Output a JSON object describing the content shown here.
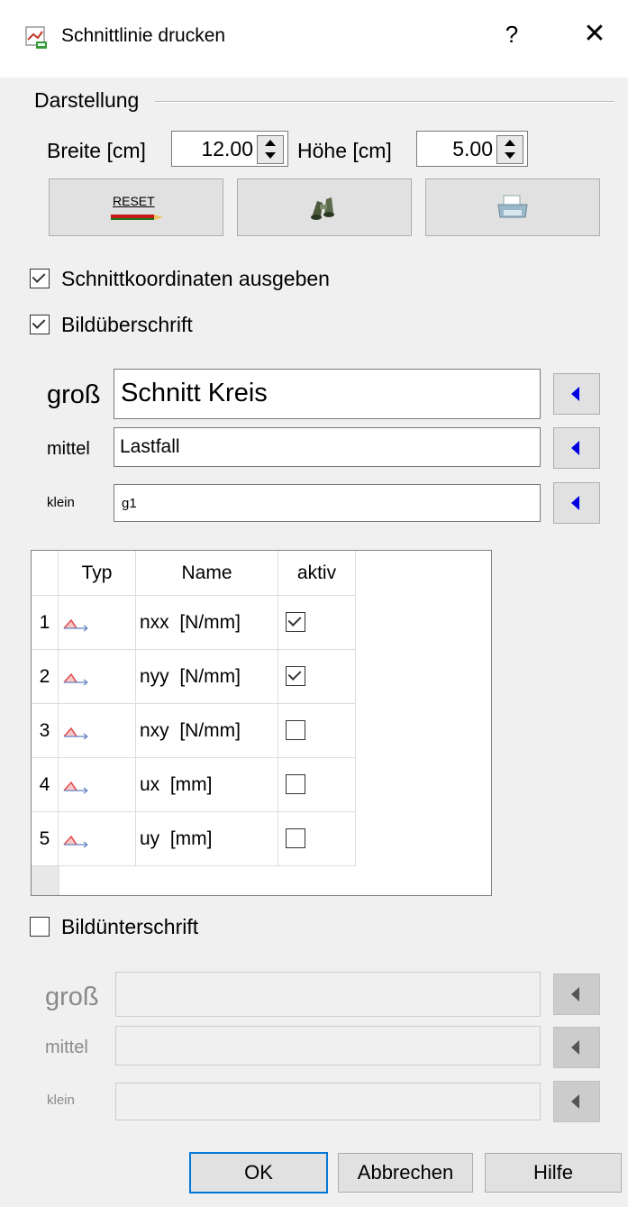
{
  "window": {
    "title": "Schnittlinie drucken",
    "help_label": "?",
    "close_label": "✕"
  },
  "darstellung": {
    "group_label": "Darstellung",
    "breite_label": "Breite [cm]",
    "breite_value": "12.00",
    "hoehe_label": "Höhe [cm]",
    "hoehe_value": "5.00",
    "reset_label": "RESET"
  },
  "options": {
    "schnittkoordinaten_label": "Schnittkoordinaten ausgeben",
    "schnittkoordinaten_checked": true,
    "bildueberschrift_label": "Bildüberschrift",
    "bildueberschrift_checked": true
  },
  "heading": {
    "gross_label": "groß",
    "gross_value": "Schnitt Kreis",
    "mittel_label": "mittel",
    "mittel_value": "Lastfall",
    "klein_label": "klein",
    "klein_value": "g1"
  },
  "table": {
    "headers": {
      "typ": "Typ",
      "name": "Name",
      "aktiv": "aktiv"
    },
    "rows": [
      {
        "num": "1",
        "name": "nxx  [N/mm]",
        "aktiv": true
      },
      {
        "num": "2",
        "name": "nyy  [N/mm]",
        "aktiv": true
      },
      {
        "num": "3",
        "name": "nxy  [N/mm]",
        "aktiv": false
      },
      {
        "num": "4",
        "name": "ux  [mm]",
        "aktiv": false
      },
      {
        "num": "5",
        "name": "uy  [mm]",
        "aktiv": false
      }
    ]
  },
  "caption": {
    "bildunterschrift_label": "Bildünterschrift",
    "bildunterschrift_checked": false,
    "gross_label": "groß",
    "gross_value": "",
    "mittel_label": "mittel",
    "mittel_value": "",
    "klein_label": "klein",
    "klein_value": ""
  },
  "footer": {
    "ok_label": "OK",
    "cancel_label": "Abbrechen",
    "help_label": "Hilfe"
  },
  "colors": {
    "accent_arrow": "#0000e0",
    "default_border": "#0078d7"
  }
}
